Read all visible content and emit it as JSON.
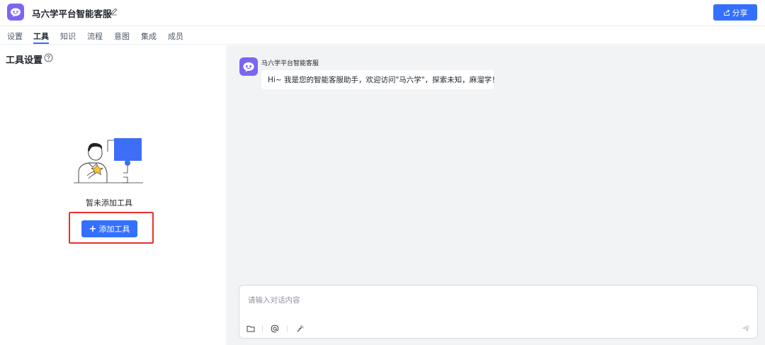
{
  "header": {
    "app_title": "马六学平台智能客服",
    "share_label": "分享",
    "logo_icon": "chat-bot-icon",
    "edit_icon": "pencil-icon",
    "share_icon": "share-icon"
  },
  "tabs": [
    {
      "label": "设置",
      "active": false
    },
    {
      "label": "工具",
      "active": true
    },
    {
      "label": "知识",
      "active": false
    },
    {
      "label": "流程",
      "active": false
    },
    {
      "label": "意图",
      "active": false
    },
    {
      "label": "集成",
      "active": false
    },
    {
      "label": "成员",
      "active": false
    }
  ],
  "tools_panel": {
    "title": "工具设置",
    "help_icon": "question-circle-icon",
    "empty_text": "暂未添加工具",
    "add_button_label": "添加工具",
    "add_button_prefix": "+"
  },
  "chat": {
    "bot_name": "马六学平台智能客服",
    "welcome_message": "Hi~ 我是您的智能客服助手，欢迎访问\"马六学\"，探索未知，麻溜学！",
    "input_placeholder": "请输入对话内容",
    "toolbar_icons": [
      "folder-icon",
      "at-icon",
      "magic-wand-icon"
    ],
    "send_icon": "send-icon"
  },
  "colors": {
    "primary": "#3370ff",
    "brand_purple": "#7b66f0",
    "highlight_red": "#e8322b",
    "chat_bg": "#f2f3f5"
  }
}
